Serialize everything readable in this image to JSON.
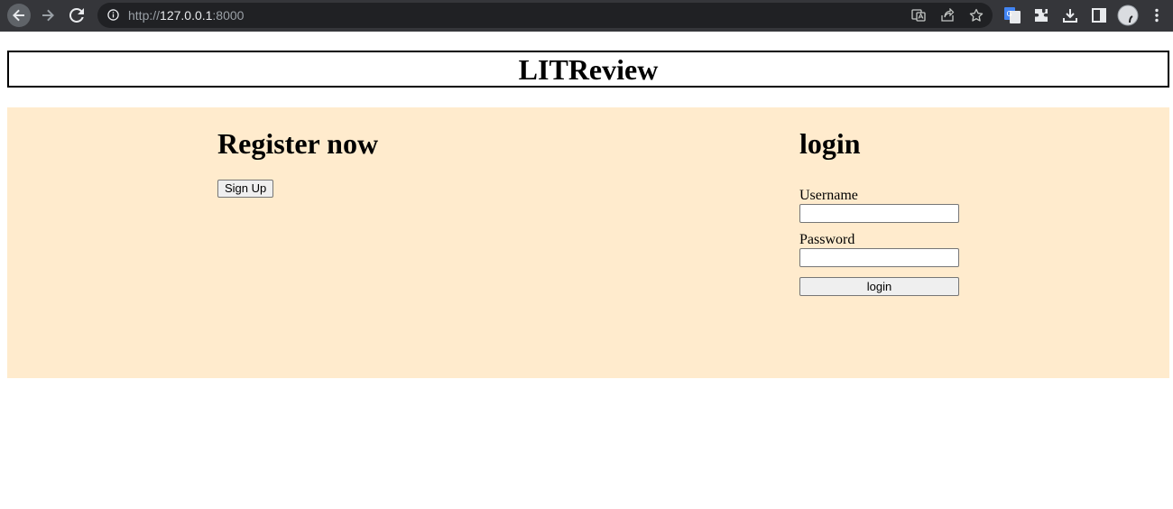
{
  "browser": {
    "url_scheme": "http://",
    "url_host": "127.0.0.1",
    "url_port": ":8000",
    "toolbar_icons": [
      "back-icon",
      "forward-icon",
      "reload-icon",
      "info-icon",
      "translate-icon",
      "share-icon",
      "star-icon",
      "google-translate-extension-icon",
      "puzzle-icon",
      "download-icon",
      "side-panel-icon",
      "profile-avatar",
      "menu-icon"
    ],
    "colors": {
      "frame": "#35363a",
      "omnibox": "#202124"
    }
  },
  "header": {
    "title": "LITReview"
  },
  "register": {
    "title": "Register now",
    "signup_label": "Sign Up"
  },
  "login": {
    "title": "login",
    "username_label": "Username",
    "username_value": "",
    "password_label": "Password",
    "password_value": "",
    "submit_label": "login"
  },
  "colors": {
    "panel_background": "#ffebcd",
    "header_border": "#000000"
  }
}
